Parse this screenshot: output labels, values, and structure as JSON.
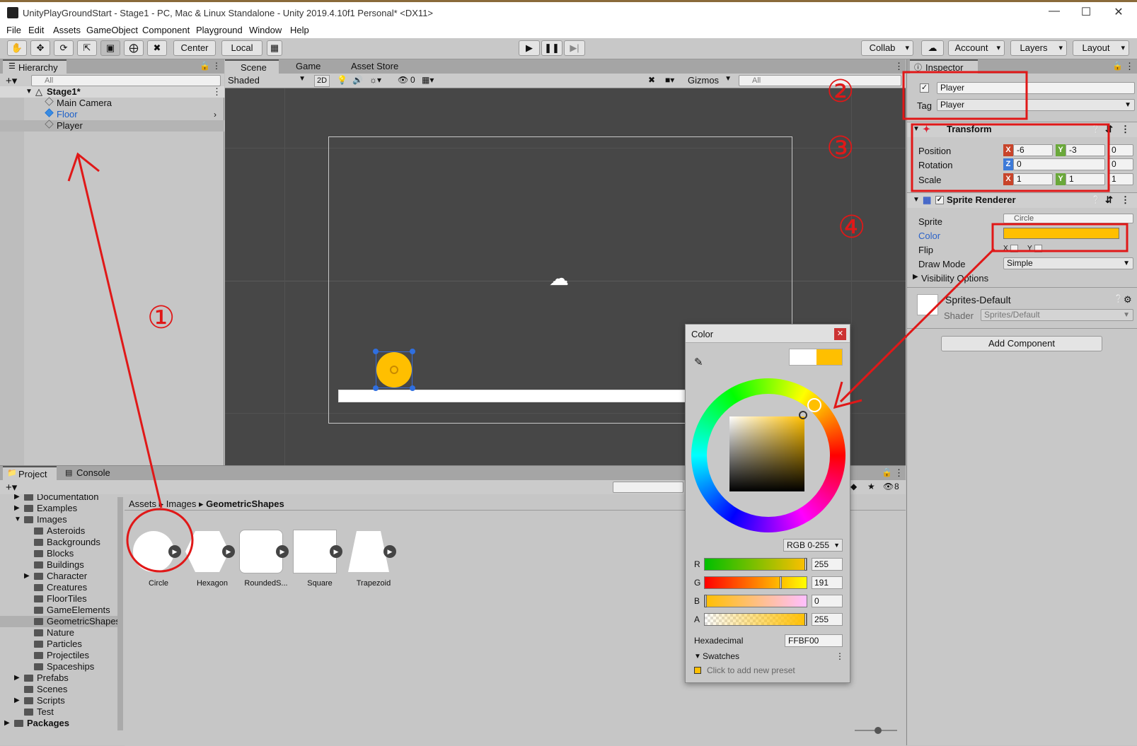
{
  "window": {
    "title": "UnityPlayGroundStart - Stage1 - PC, Mac & Linux Standalone - Unity 2019.4.10f1 Personal* <DX11>"
  },
  "menu": [
    "File",
    "Edit",
    "Assets",
    "GameObject",
    "Component",
    "Playground",
    "Window",
    "Help"
  ],
  "toolbar": {
    "pivot": "Center",
    "space": "Local",
    "collab": "Collab",
    "account": "Account",
    "layers": "Layers",
    "layout": "Layout"
  },
  "hierarchy": {
    "tab": "Hierarchy",
    "search_placeholder": "All",
    "scene": "Stage1*",
    "items": [
      "Main Camera",
      "Floor",
      "Player"
    ]
  },
  "scene": {
    "tabs": [
      "Scene",
      "Game",
      "Asset Store"
    ],
    "shading": "Shaded",
    "mode_2d": "2D",
    "hidden_count": "0",
    "gizmos": "Gizmos",
    "search_placeholder": "All"
  },
  "inspector": {
    "tab": "Inspector",
    "name": "Player",
    "tag_label": "Tag",
    "tag": "Player",
    "transform": {
      "title": "Transform",
      "position_label": "Position",
      "position": {
        "x": "-6",
        "y": "-3",
        "z": "0"
      },
      "rotation_label": "Rotation",
      "rotation": {
        "z": "0",
        "extra": "0"
      },
      "scale_label": "Scale",
      "scale": {
        "x": "1",
        "y": "1",
        "z": "1"
      }
    },
    "sprite_renderer": {
      "title": "Sprite Renderer",
      "sprite_label": "Sprite",
      "sprite": "Circle",
      "color_label": "Color",
      "color": "#FFBF00",
      "flip_label": "Flip",
      "flip_x": "X",
      "flip_y": "Y",
      "draw_mode_label": "Draw Mode",
      "draw_mode": "Simple",
      "visibility_label": "Visibility Options"
    },
    "material": {
      "title": "Sprites-Default",
      "shader_label": "Shader",
      "shader": "Sprites/Default"
    },
    "add_component": "Add Component"
  },
  "project": {
    "tabs": [
      "Project",
      "Console"
    ],
    "breadcrumb": [
      "Assets",
      "Images",
      "GeometricShapes"
    ],
    "badge_count": "8",
    "tree": [
      {
        "label": "Documentation",
        "indent": 1,
        "arrow": true
      },
      {
        "label": "Examples",
        "indent": 1,
        "arrow": true
      },
      {
        "label": "Images",
        "indent": 1,
        "arrow": true,
        "open": true
      },
      {
        "label": "Asteroids",
        "indent": 2
      },
      {
        "label": "Backgrounds",
        "indent": 2
      },
      {
        "label": "Blocks",
        "indent": 2
      },
      {
        "label": "Buildings",
        "indent": 2
      },
      {
        "label": "Character",
        "indent": 2,
        "arrow": true
      },
      {
        "label": "Creatures",
        "indent": 2
      },
      {
        "label": "FloorTiles",
        "indent": 2
      },
      {
        "label": "GameElements",
        "indent": 2
      },
      {
        "label": "GeometricShapes",
        "indent": 2,
        "selected": true
      },
      {
        "label": "Nature",
        "indent": 2
      },
      {
        "label": "Particles",
        "indent": 2
      },
      {
        "label": "Projectiles",
        "indent": 2
      },
      {
        "label": "Spaceships",
        "indent": 2
      },
      {
        "label": "Prefabs",
        "indent": 1,
        "arrow": true
      },
      {
        "label": "Scenes",
        "indent": 1
      },
      {
        "label": "Scripts",
        "indent": 1,
        "arrow": true
      },
      {
        "label": "Test",
        "indent": 1
      },
      {
        "label": "Packages",
        "indent": 0,
        "arrow": true,
        "bold": true
      }
    ],
    "assets": [
      "Circle",
      "Hexagon",
      "RoundedS...",
      "Square",
      "Trapezoid"
    ]
  },
  "color_picker": {
    "title": "Color",
    "mode": "RGB 0-255",
    "channels": [
      {
        "label": "R",
        "value": "255",
        "fraction": 1.0
      },
      {
        "label": "G",
        "value": "191",
        "fraction": 0.749
      },
      {
        "label": "B",
        "value": "0",
        "fraction": 0.0
      },
      {
        "label": "A",
        "value": "255",
        "fraction": 1.0
      }
    ],
    "hex_label": "Hexadecimal",
    "hex": "FFBF00",
    "swatches_label": "Swatches",
    "swatches_hint": "Click to add new preset"
  },
  "annotations": [
    "①",
    "②",
    "③",
    "④"
  ],
  "colors": {
    "accent_red": "#e01818",
    "player_color": "#FFBF00",
    "panel_bg": "#c6c6c6",
    "scene_bg": "#474747"
  }
}
